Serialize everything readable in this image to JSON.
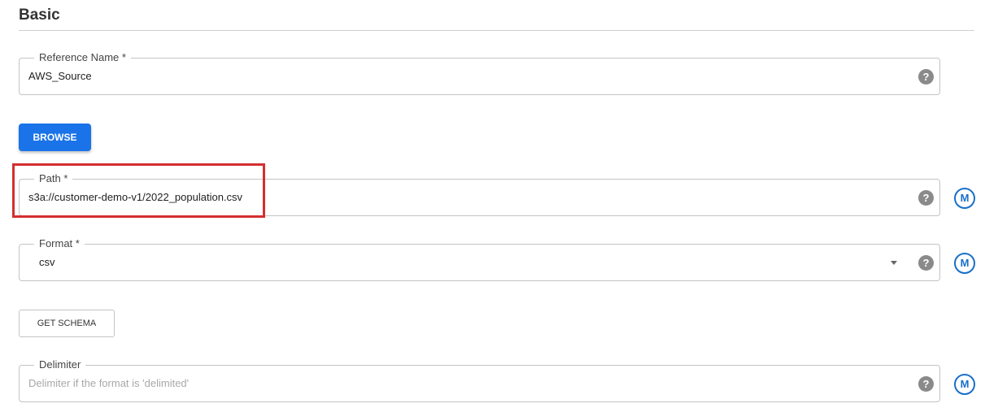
{
  "section": {
    "title": "Basic"
  },
  "reference_name": {
    "label": "Reference Name",
    "required_mark": "*",
    "value": "AWS_Source",
    "help_icon": "help-circle-icon",
    "help_glyph": "?"
  },
  "browse_button": {
    "label": "BROWSE"
  },
  "path": {
    "label": "Path",
    "required_mark": "*",
    "value": "s3a://customer-demo-v1/2022_population.csv",
    "help_icon": "help-circle-icon",
    "help_glyph": "?",
    "macro_icon": "macro-icon",
    "macro_glyph": "M"
  },
  "format": {
    "label": "Format",
    "required_mark": "*",
    "selected": "csv",
    "help_icon": "help-circle-icon",
    "help_glyph": "?",
    "macro_glyph": "M"
  },
  "get_schema_button": {
    "label": "GET SCHEMA"
  },
  "delimiter": {
    "label": "Delimiter",
    "value": "",
    "placeholder": "Delimiter if the format is 'delimited'",
    "help_icon": "help-circle-icon",
    "help_glyph": "?",
    "macro_glyph": "M"
  },
  "colors": {
    "primary": "#1a73e8",
    "macro": "#1a6fc9",
    "highlight": "#d32f2f"
  }
}
